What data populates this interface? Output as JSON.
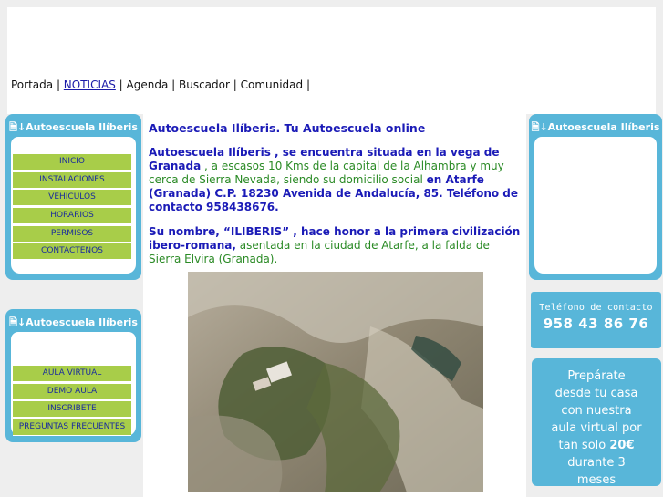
{
  "topnav": {
    "items": [
      {
        "label": "Portada",
        "link": false
      },
      {
        "label": "NOTICIAS",
        "link": true
      },
      {
        "label": "Agenda",
        "link": false
      },
      {
        "label": "Buscador",
        "link": false
      },
      {
        "label": "Comunidad",
        "link": false
      }
    ],
    "separator": " | "
  },
  "left_box_1": {
    "header": "Autoescuela Ilíberis",
    "items": [
      "INICIO",
      "INSTALACIONES",
      "VEHÍCULOS",
      "HORARIOS",
      "PERMISOS",
      "CONTACTENOS"
    ]
  },
  "left_box_2": {
    "header": "Autoescuela Ilíberis",
    "items": [
      "AULA VIRTUAL",
      "DEMO AULA",
      "INSCRIBETE",
      "PREGUNTAS FRECUENTES"
    ]
  },
  "right_box": {
    "header": "Autoescuela Ilíberis"
  },
  "content": {
    "title": "Autoescuela Ilíberis. Tu Autoescuela online",
    "p1": {
      "a": "Autoescuela Ilíberis , se encuentra situada en la vega de Granada",
      "b": " , a escasos 10 Kms de la capital de la Alhambra y muy cerca de Sierra Nevada, siendo su domicilio social ",
      "c": "en Atarfe (Granada) C.P. 18230 Avenida de Andalucía, 85. Teléfono de contacto 958438676."
    },
    "p2": {
      "a": "Su nombre, “ILIBERIS” , hace honor a la primera civilización ibero-romana,",
      "b": " asentada en la ciudad de Atarfe, a la falda de Sierra Elvira (Granada)."
    }
  },
  "phone": {
    "label": "Teléfono de contacto",
    "number": "958 43 86 76"
  },
  "promo": {
    "lines": [
      "Prepárate",
      "desde tu casa",
      "con nuestra",
      "aula virtual por"
    ],
    "price_prefix": "tan solo ",
    "price": "20€",
    "lines_after": [
      "durante 3",
      "meses"
    ]
  },
  "colors": {
    "accent_blue": "#58b6d9",
    "menu_green": "#a8cd49",
    "text_blue": "#1b1bb7",
    "text_green": "#2a8a25"
  }
}
